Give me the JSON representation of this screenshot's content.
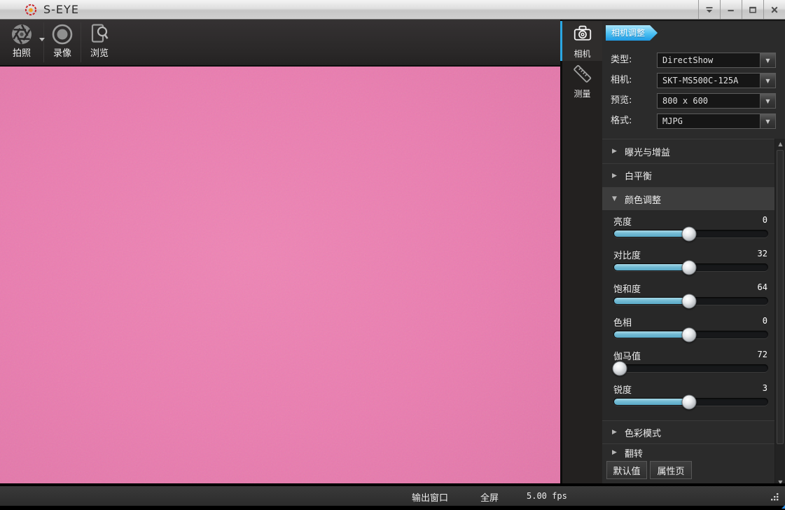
{
  "window": {
    "title": "S-EYE"
  },
  "toolbar": {
    "buttons": [
      {
        "label": "拍照"
      },
      {
        "label": "录像"
      },
      {
        "label": "浏览"
      }
    ]
  },
  "side_tabs": [
    {
      "label": "相机"
    },
    {
      "label": "测量"
    }
  ],
  "panel": {
    "tab_label": "相机调整",
    "combos": [
      {
        "label": "类型:",
        "value": "DirectShow"
      },
      {
        "label": "相机:",
        "value": "SKT-MS500C-125A"
      },
      {
        "label": "预览:",
        "value": "800 x 600"
      },
      {
        "label": "格式:",
        "value": "MJPG"
      }
    ],
    "sections": [
      {
        "label": "曝光与增益",
        "expanded": false
      },
      {
        "label": "白平衡",
        "expanded": false
      },
      {
        "label": "颜色调整",
        "expanded": true
      }
    ],
    "sliders": [
      {
        "label": "亮度",
        "value": "0",
        "percent": 49
      },
      {
        "label": "对比度",
        "value": "32",
        "percent": 49
      },
      {
        "label": "饱和度",
        "value": "64",
        "percent": 49
      },
      {
        "label": "色相",
        "value": "0",
        "percent": 49
      },
      {
        "label": "伽马值",
        "value": "72",
        "percent": 4
      },
      {
        "label": "锐度",
        "value": "3",
        "percent": 49
      }
    ],
    "bottom_sections": [
      {
        "label": "色彩模式",
        "expanded": false
      },
      {
        "label": "翻转",
        "expanded": false
      }
    ],
    "buttons": [
      {
        "label": "默认值"
      },
      {
        "label": "属性页"
      }
    ]
  },
  "statusbar": {
    "output_window": "输出窗口",
    "fullscreen": "全屏",
    "fps": "5.00 fps"
  },
  "glyphs": {
    "collapsed": "▶",
    "expanded": "▼",
    "combo_arrow": "▼",
    "scroll_up": "▲",
    "scroll_down": "▼"
  },
  "colors": {
    "preview_pink": "#ec80b1",
    "accent_cyan": "#2ba7e2",
    "slider_fill": "#6fb9d2",
    "flag_blue": "#2fa7e8"
  }
}
